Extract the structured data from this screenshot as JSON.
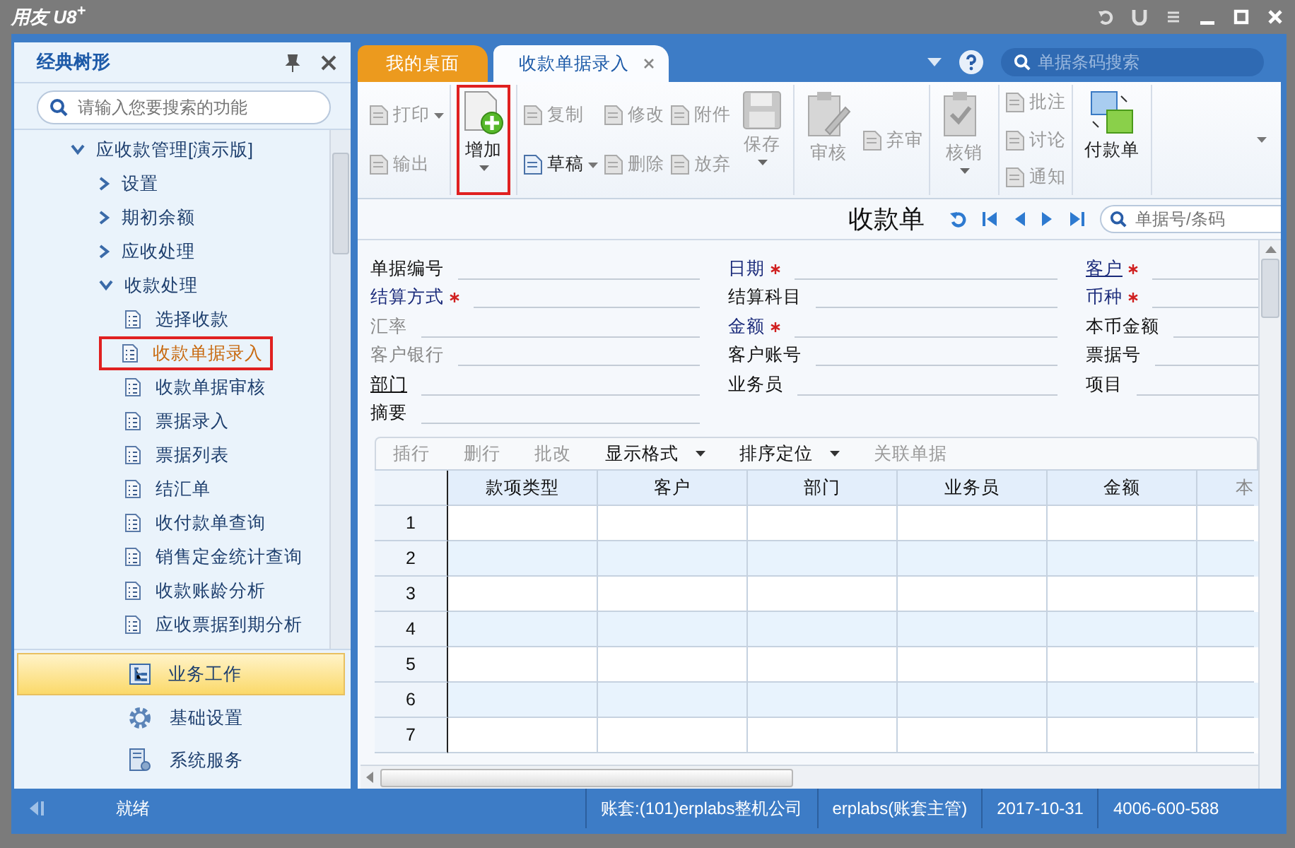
{
  "window": {
    "title": "用友 U8$^{+}$"
  },
  "sidebar": {
    "title": "经典树形",
    "search": {
      "placeholder": "请输入您要搜索的功能"
    },
    "tree": [
      {
        "label": "应收款管理[演示版]",
        "expanded": true,
        "children": [
          {
            "label": "设置",
            "expanded": false
          },
          {
            "label": "期初余额",
            "expanded": false
          },
          {
            "label": "应收处理",
            "expanded": false
          },
          {
            "label": "收款处理",
            "expanded": true,
            "children": [
              {
                "label": "选择收款",
                "selected": false,
                "highlighted": false
              },
              {
                "label": "收款单据录入",
                "selected": true,
                "highlighted": true
              },
              {
                "label": "收款单据审核",
                "selected": false,
                "highlighted": false
              },
              {
                "label": "票据录入",
                "selected": false,
                "highlighted": false
              },
              {
                "label": "票据列表",
                "selected": false,
                "highlighted": false
              },
              {
                "label": "结汇单",
                "selected": false,
                "highlighted": false
              },
              {
                "label": "收付款单查询",
                "selected": false,
                "highlighted": false
              },
              {
                "label": "销售定金统计查询",
                "selected": false,
                "highlighted": false
              },
              {
                "label": "收款账龄分析",
                "selected": false,
                "highlighted": false
              },
              {
                "label": "应收票据到期分析",
                "selected": false,
                "highlighted": false
              }
            ]
          }
        ]
      }
    ],
    "nav": [
      {
        "label": "业务工作",
        "selected": true
      },
      {
        "label": "基础设置",
        "selected": false
      },
      {
        "label": "系统服务",
        "selected": false
      }
    ]
  },
  "tabs": [
    {
      "label": "我的桌面",
      "selected": false,
      "closable": false
    },
    {
      "label": "收款单据录入",
      "selected": true,
      "closable": true
    }
  ],
  "header_search": {
    "placeholder": "单据条码搜索"
  },
  "toolbar": {
    "groups": [
      {
        "columns": [
          {
            "kind": "small",
            "items": [
              {
                "label": "打印",
                "disabled": true,
                "dropdown": true
              },
              {
                "label": "输出",
                "disabled": true,
                "dropdown": false
              }
            ]
          }
        ]
      },
      {
        "columns": [
          {
            "kind": "large",
            "label": "增加",
            "disabled": false,
            "dropdown": true,
            "highlighted": true
          }
        ]
      },
      {
        "columns": [
          {
            "kind": "small",
            "items": [
              {
                "label": "复制",
                "disabled": true,
                "dropdown": false
              },
              {
                "label": "草稿",
                "disabled": false,
                "dropdown": true
              }
            ]
          },
          {
            "kind": "small",
            "items": [
              {
                "label": "修改",
                "disabled": true,
                "dropdown": false
              },
              {
                "label": "删除",
                "disabled": true,
                "dropdown": false
              }
            ]
          },
          {
            "kind": "small",
            "items": [
              {
                "label": "附件",
                "disabled": true,
                "dropdown": false
              },
              {
                "label": "放弃",
                "disabled": true,
                "dropdown": false
              }
            ]
          },
          {
            "kind": "large",
            "label": "保存",
            "disabled": true,
            "dropdown": true,
            "highlighted": false
          }
        ]
      },
      {
        "columns": [
          {
            "kind": "large",
            "label": "审核",
            "disabled": true,
            "dropdown": false,
            "highlighted": false
          },
          {
            "kind": "small",
            "items": [
              {
                "label": "弃审",
                "disabled": true,
                "dropdown": false
              }
            ]
          }
        ]
      },
      {
        "columns": [
          {
            "kind": "large",
            "label": "核销",
            "disabled": true,
            "dropdown": true,
            "highlighted": false
          }
        ]
      },
      {
        "columns": [
          {
            "kind": "small",
            "items": [
              {
                "label": "批注",
                "disabled": true,
                "dropdown": false
              },
              {
                "label": "讨论",
                "disabled": true,
                "dropdown": false
              },
              {
                "label": "通知",
                "disabled": true,
                "dropdown": false
              }
            ]
          }
        ]
      },
      {
        "columns": [
          {
            "kind": "large",
            "label": "付款单",
            "disabled": false,
            "dropdown": false,
            "highlighted": false
          }
        ]
      }
    ]
  },
  "document": {
    "title": "收款单",
    "search": {
      "placeholder": "单据号/条码"
    },
    "fields": [
      {
        "label": "单据编号",
        "required": false,
        "disabled": false,
        "underlined": false
      },
      {
        "label": "日期",
        "required": true,
        "disabled": false,
        "underlined": false
      },
      {
        "label": "客户",
        "required": true,
        "disabled": false,
        "underlined": true
      },
      {
        "label": "结算方式",
        "required": true,
        "disabled": false,
        "underlined": false
      },
      {
        "label": "结算科目",
        "required": false,
        "disabled": false,
        "underlined": false
      },
      {
        "label": "币种",
        "required": true,
        "disabled": false,
        "underlined": false
      },
      {
        "label": "汇率",
        "required": false,
        "disabled": true,
        "underlined": false
      },
      {
        "label": "金额",
        "required": true,
        "disabled": false,
        "underlined": false
      },
      {
        "label": "本币金额",
        "required": false,
        "disabled": false,
        "underlined": false
      },
      {
        "label": "客户银行",
        "required": false,
        "disabled": true,
        "underlined": false
      },
      {
        "label": "客户账号",
        "required": false,
        "disabled": false,
        "underlined": false
      },
      {
        "label": "票据号",
        "required": false,
        "disabled": false,
        "underlined": false
      },
      {
        "label": "部门",
        "required": false,
        "disabled": false,
        "underlined": true
      },
      {
        "label": "业务员",
        "required": false,
        "disabled": false,
        "underlined": false
      },
      {
        "label": "项目",
        "required": false,
        "disabled": false,
        "underlined": false
      },
      {
        "label": "摘要",
        "required": false,
        "disabled": false,
        "underlined": false
      }
    ],
    "grid_toolbar": [
      {
        "label": "插行",
        "disabled": true,
        "dropdown": false
      },
      {
        "label": "删行",
        "disabled": true,
        "dropdown": false
      },
      {
        "label": "批改",
        "disabled": true,
        "dropdown": false
      },
      {
        "label": "显示格式",
        "disabled": false,
        "dropdown": true
      },
      {
        "label": "排序定位",
        "disabled": false,
        "dropdown": true
      },
      {
        "label": "关联单据",
        "disabled": true,
        "dropdown": false
      }
    ],
    "table": {
      "columns": [
        "款项类型",
        "客户",
        "部门",
        "业务员",
        "金额",
        "本"
      ],
      "rows": [
        "1",
        "2",
        "3",
        "4",
        "5",
        "6",
        "7"
      ]
    }
  },
  "status_bar": {
    "status": "就绪",
    "account": "账套:(101)erplabs整机公司",
    "user": "erplabs(账套主管)",
    "date": "2017-10-31",
    "phone": "4006-600-588"
  }
}
